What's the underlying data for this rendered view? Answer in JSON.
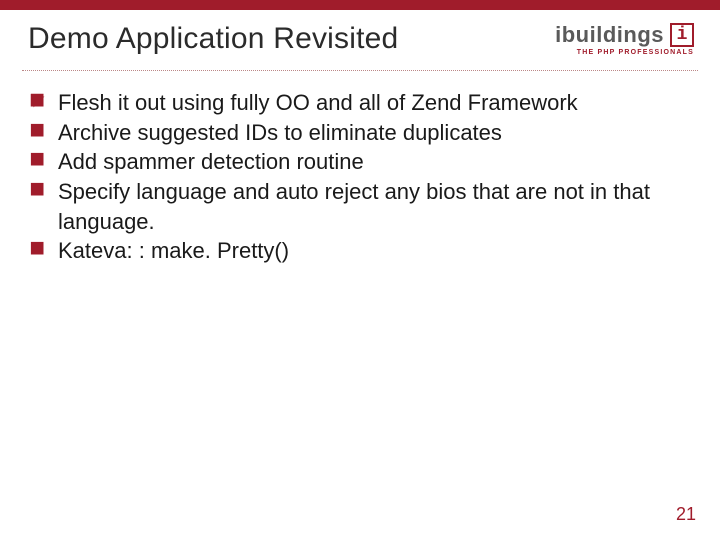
{
  "title": "Demo Application Revisited",
  "logo": {
    "name": "ibuildings",
    "boxLetter": "i",
    "tagline": "THE PHP PROFESSIONALS"
  },
  "bullets": [
    "Flesh it out using fully OO and all of Zend Framework",
    "Archive suggested IDs to eliminate duplicates",
    "Add spammer detection routine",
    "Specify language and auto reject any bios that are not in that language.",
    "Kateva: : make. Pretty()"
  ],
  "pageNumber": "21"
}
